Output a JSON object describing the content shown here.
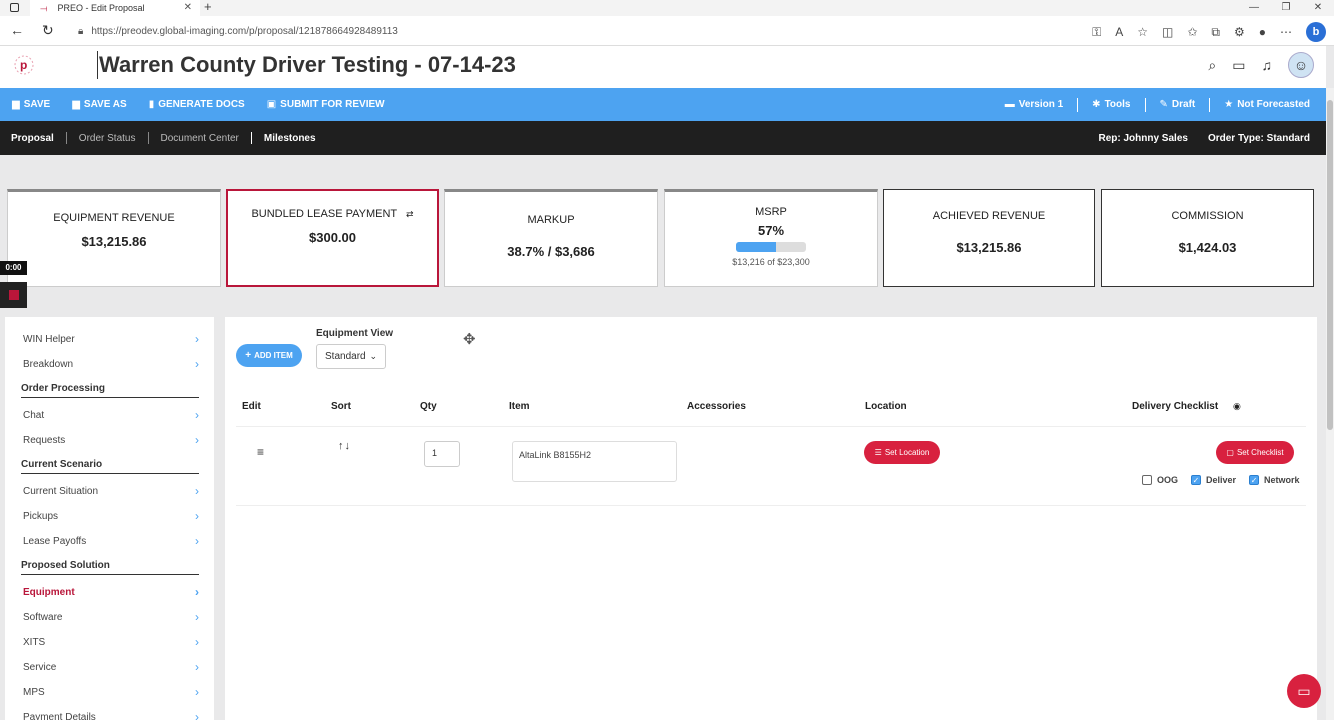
{
  "browser": {
    "tab_title": "PREO - Edit Proposal",
    "url": "https://preodev.global-imaging.com/p/proposal/121878664928489113"
  },
  "header": {
    "title": "Warren County Driver Testing - 07-14-23"
  },
  "toolbar": {
    "save": "SAVE",
    "save_as": "SAVE AS",
    "generate_docs": "GENERATE DOCS",
    "submit": "SUBMIT FOR REVIEW",
    "version": "Version 1",
    "tools": "Tools",
    "draft": "Draft",
    "forecast": "Not Forecasted"
  },
  "subnav": {
    "items": [
      "Proposal",
      "Order Status",
      "Document Center",
      "Milestones"
    ],
    "rep": "Rep: Johnny Sales",
    "order_type": "Order Type: Standard"
  },
  "cards": {
    "equipment_revenue": {
      "label": "EQUIPMENT REVENUE",
      "value": "$13,215.86"
    },
    "bundled_lease": {
      "label": "BUNDLED LEASE PAYMENT",
      "value": "$300.00"
    },
    "markup": {
      "label": "MARKUP",
      "value": "38.7% / $3,686"
    },
    "msrp": {
      "label": "MSRP",
      "value": "57%",
      "progress": 0.57,
      "sub": "$13,216 of $23,300"
    },
    "achieved_revenue": {
      "label": "ACHIEVED REVENUE",
      "value": "$13,215.86"
    },
    "commission": {
      "label": "COMMISSION",
      "value": "$1,424.03"
    }
  },
  "recorder": {
    "time": "0:00"
  },
  "sidebar": {
    "items": [
      {
        "label": "WIN Helper"
      },
      {
        "label": "Breakdown"
      },
      {
        "label": "Chat"
      },
      {
        "label": "Requests"
      },
      {
        "label": "Current Situation"
      },
      {
        "label": "Pickups"
      },
      {
        "label": "Lease Payoffs"
      },
      {
        "label": "Equipment"
      },
      {
        "label": "Software"
      },
      {
        "label": "XITS"
      },
      {
        "label": "Service"
      },
      {
        "label": "MPS"
      },
      {
        "label": "Payment Details"
      }
    ],
    "headers": [
      "Order Processing",
      "Current Scenario",
      "Proposed Solution"
    ]
  },
  "main": {
    "add_item": "ADD ITEM",
    "equipment_view_label": "Equipment View",
    "equipment_view_value": "Standard",
    "columns": [
      "Edit",
      "Sort",
      "Qty",
      "Item",
      "Accessories",
      "Location",
      "Delivery Checklist"
    ],
    "row": {
      "qty": "1",
      "item": "AltaLink B8155H2",
      "set_location": "Set Location",
      "set_checklist": "Set Checklist",
      "checks": [
        {
          "label": "OOG",
          "checked": false
        },
        {
          "label": "Deliver",
          "checked": true
        },
        {
          "label": "Network",
          "checked": true
        }
      ]
    }
  }
}
